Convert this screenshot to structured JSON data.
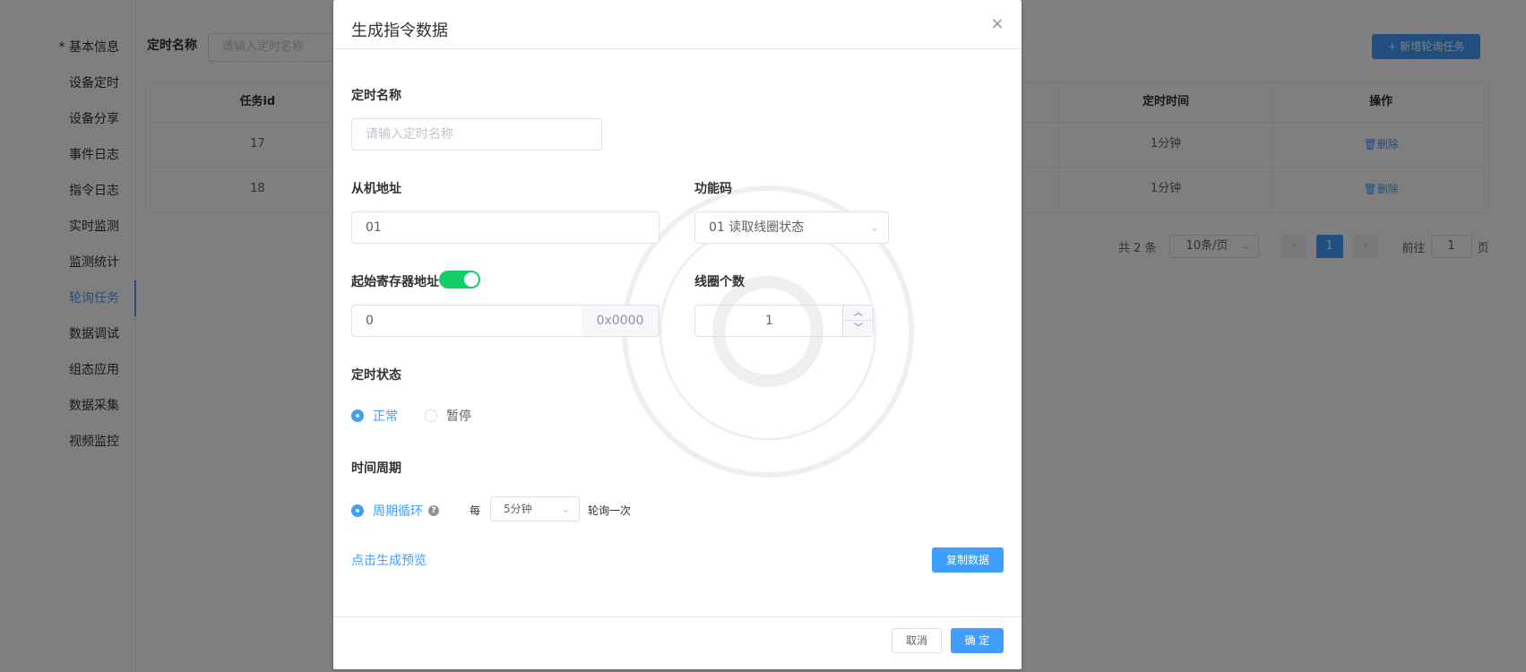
{
  "background": {
    "nav_items": [
      {
        "label": "* 基本信息"
      },
      {
        "label": "设备定时"
      },
      {
        "label": "设备分享"
      },
      {
        "label": "事件日志"
      },
      {
        "label": "指令日志"
      },
      {
        "label": "实时监测"
      },
      {
        "label": "监测统计"
      },
      {
        "label": "轮询任务",
        "active": true
      },
      {
        "label": "数据调试"
      },
      {
        "label": "组态应用"
      },
      {
        "label": "数据采集"
      },
      {
        "label": "视频监控"
      }
    ],
    "filter_label": "定时名称",
    "filter_placeholder": "请输入定时名称",
    "add_button": "+ 新增轮询任务",
    "table": {
      "headers": [
        "任务id",
        "",
        "定时时间",
        "操作"
      ],
      "rows": [
        {
          "id": "17",
          "time": "1分钟",
          "action": "🗑删除"
        },
        {
          "id": "18",
          "time": "1分钟",
          "action": "🗑删除"
        }
      ]
    },
    "pager": {
      "total": "共 2 条",
      "page_size": "10条/页",
      "prev": "‹",
      "current": "1",
      "next": "›",
      "goto_label": "前往",
      "goto_value": "1",
      "page_suffix": "页"
    }
  },
  "dialog": {
    "title": "生成指令数据",
    "close_icon": "×",
    "timer_name_label": "定时名称",
    "timer_name_placeholder": "请输入定时名称",
    "slave_address_label": "从机地址",
    "slave_address_value": "01",
    "function_code_label": "功能码",
    "function_code_value": "01 读取线圈状态",
    "start_register_label": "起始寄存器地址",
    "start_register_value": "0",
    "start_register_hex": "0x0000",
    "hex_switch_on": true,
    "coil_count_label": "线圈个数",
    "coil_count_value": "1",
    "timer_status_label": "定时状态",
    "status_options": [
      {
        "label": "正常",
        "checked": true
      },
      {
        "label": "暂停",
        "checked": false
      }
    ],
    "time_period_label": "时间周期",
    "cycle_label": "周期循环",
    "cycle_help": "?",
    "every_label": "每",
    "interval_value": "5分钟",
    "poll_once_label": "轮询一次",
    "preview_link": "点击生成预览",
    "copy_button": "复制数据",
    "cancel_button": "取消",
    "confirm_button": "确 定"
  },
  "colors": {
    "primary": "#409eff",
    "switch_on": "#13ce66",
    "mask": "rgba(0,0,0,0.5)"
  }
}
